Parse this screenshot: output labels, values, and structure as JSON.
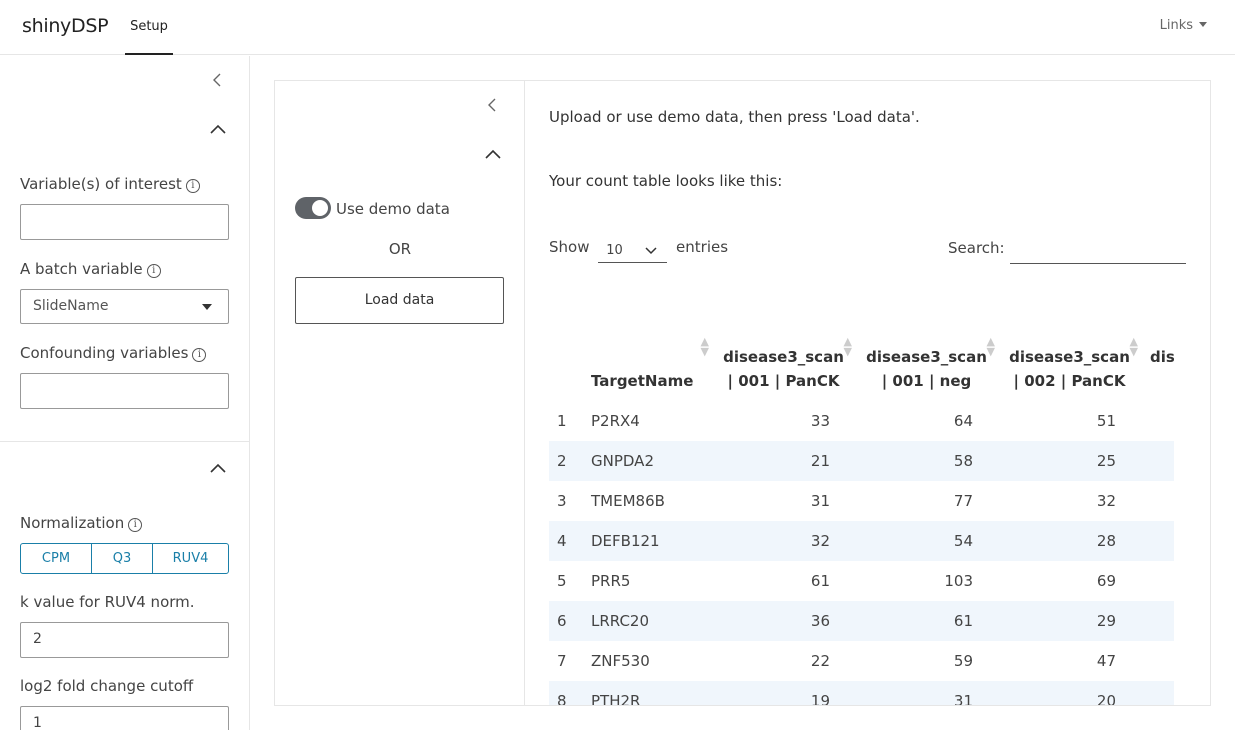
{
  "nav": {
    "brand": "shinyDSP",
    "tab": "Setup",
    "links": "Links"
  },
  "sidebar": {
    "variables_label": "Variable(s) of interest",
    "variables_value": "",
    "batch_label": "A batch variable",
    "batch_value": "SlideName",
    "confounding_label": "Confounding variables",
    "confounding_value": "",
    "normalization_label": "Normalization",
    "normalization_options": [
      "CPM",
      "Q3",
      "RUV4"
    ],
    "k_label": "k value for RUV4 norm.",
    "k_value": "2",
    "logfc_label": "log2 fold change cutoff",
    "logfc_value": "1"
  },
  "upload": {
    "toggle_label": "Use demo data",
    "toggle_on": true,
    "or_text": "OR",
    "load_button": "Load data"
  },
  "main": {
    "instructions": "Upload or use demo data, then press 'Load data'.",
    "count_msg": "Your count table looks like this:",
    "show_label": "Show",
    "entries_value": "10",
    "entries_label": "entries",
    "search_label": "Search:",
    "search_value": ""
  },
  "table": {
    "columns": [
      "",
      "TargetName",
      "disease3_scan | 001 | PanCK",
      "disease3_scan | 001 | neg",
      "disease3_scan | 002 | PanCK",
      "dis"
    ],
    "rows": [
      [
        "1",
        "P2RX4",
        "33",
        "64",
        "51"
      ],
      [
        "2",
        "GNPDA2",
        "21",
        "58",
        "25"
      ],
      [
        "3",
        "TMEM86B",
        "31",
        "77",
        "32"
      ],
      [
        "4",
        "DEFB121",
        "32",
        "54",
        "28"
      ],
      [
        "5",
        "PRR5",
        "61",
        "103",
        "69"
      ],
      [
        "6",
        "LRRC20",
        "36",
        "61",
        "29"
      ],
      [
        "7",
        "ZNF530",
        "22",
        "59",
        "47"
      ],
      [
        "8",
        "PTH2R",
        "19",
        "31",
        "20"
      ]
    ]
  }
}
